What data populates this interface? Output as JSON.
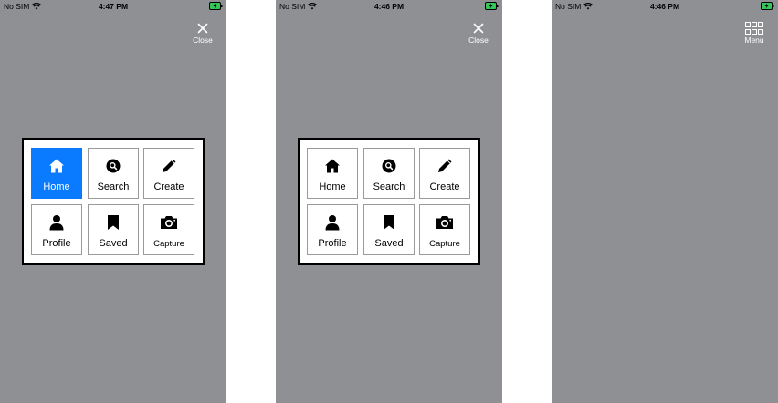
{
  "status": {
    "carrier": "No SIM",
    "times": [
      "4:47 PM",
      "4:46 PM",
      "4:46 PM"
    ]
  },
  "buttons": {
    "close_label": "Close",
    "menu_label": "Menu"
  },
  "menu": {
    "items": [
      {
        "label": "Home",
        "icon": "home-icon"
      },
      {
        "label": "Search",
        "icon": "search-icon"
      },
      {
        "label": "Create",
        "icon": "pencil-icon"
      },
      {
        "label": "Profile",
        "icon": "person-icon"
      },
      {
        "label": "Saved",
        "icon": "bookmark-icon"
      },
      {
        "label": "Capture",
        "icon": "camera-icon"
      }
    ],
    "active_color": "#0a7aff"
  },
  "colors": {
    "background": "#8f9094",
    "battery_charging": "#34c759"
  }
}
